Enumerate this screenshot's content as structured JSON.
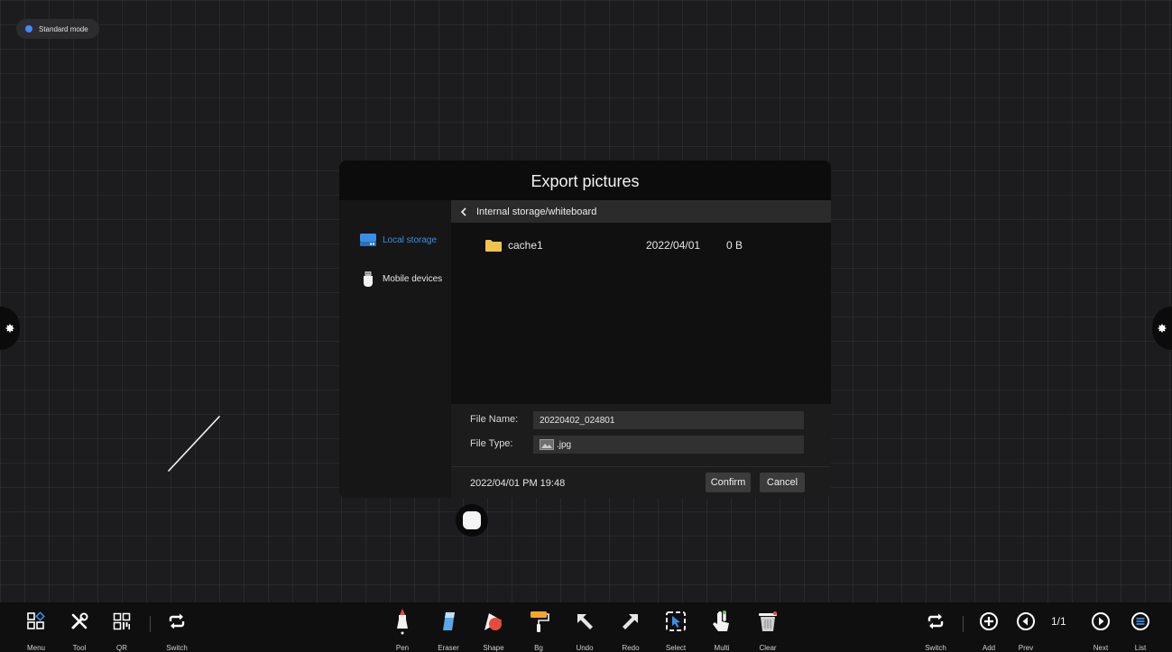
{
  "mode": {
    "label": "Standard mode"
  },
  "dialog": {
    "title": "Export pictures",
    "sources": [
      {
        "label": "Local storage",
        "icon": "hard-drive-icon",
        "active": true
      },
      {
        "label": "Mobile devices",
        "icon": "usb-drive-icon",
        "active": false
      }
    ],
    "path": "Internal storage/whiteboard",
    "files": [
      {
        "name": "cache1",
        "date": "2022/04/01",
        "size": "0 B",
        "icon": "folder-icon"
      }
    ],
    "file_name_label": "File Name:",
    "file_name_value": "20220402_024801",
    "file_type_label": "File Type:",
    "file_type_value": ".jpg",
    "timestamp": "2022/04/01 PM 19:48",
    "confirm_label": "Confirm",
    "cancel_label": "Cancel"
  },
  "toolbar": {
    "left": [
      {
        "label": "Menu",
        "icon": "menu-grid-icon"
      },
      {
        "label": "Tool",
        "icon": "tools-icon"
      },
      {
        "label": "QR",
        "icon": "qr-code-icon"
      },
      {
        "label": "Switch",
        "icon": "switch-icon"
      }
    ],
    "center": [
      {
        "label": "Pen",
        "icon": "pen-icon"
      },
      {
        "label": "Eraser",
        "icon": "eraser-icon"
      },
      {
        "label": "Shape",
        "icon": "shape-icon"
      },
      {
        "label": "Bg",
        "icon": "paint-roller-icon"
      },
      {
        "label": "Undo",
        "icon": "undo-icon"
      },
      {
        "label": "Redo",
        "icon": "redo-icon"
      },
      {
        "label": "Select",
        "icon": "select-icon"
      },
      {
        "label": "Multi",
        "icon": "multi-touch-icon"
      },
      {
        "label": "Clear",
        "icon": "trash-icon"
      }
    ],
    "right": [
      {
        "label": "Switch",
        "icon": "switch-icon"
      },
      {
        "label": "Add",
        "icon": "add-page-icon"
      },
      {
        "label": "Prev",
        "icon": "prev-page-icon"
      },
      {
        "label": "Next",
        "icon": "next-page-icon"
      },
      {
        "label": "List",
        "icon": "page-list-icon"
      }
    ],
    "page_indicator": "1/1"
  },
  "colors": {
    "accent": "#3a8ee6",
    "background": "#1c1c1e"
  }
}
